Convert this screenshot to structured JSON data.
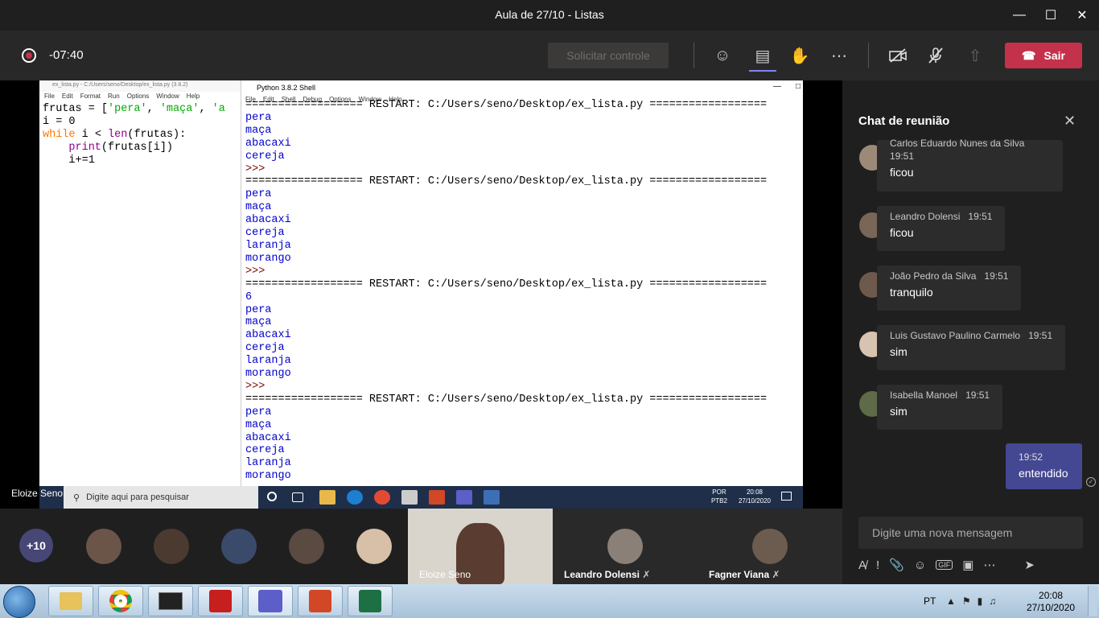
{
  "window": {
    "title": "Aula de 27/10 - Listas"
  },
  "toolbar": {
    "timer": "-07:40",
    "request_control": "Solicitar controle",
    "leave": "Sair"
  },
  "shared_screen": {
    "editor_title": "ex_lista.py - C:/Users/seno/Desktop/ex_lista.py (3.8.2)",
    "editor_menu": [
      "File",
      "Edit",
      "Format",
      "Run",
      "Options",
      "Window",
      "Help"
    ],
    "shell_title": "Python 3.8.2 Shell",
    "shell_menu": [
      "File",
      "Edit",
      "Shell",
      "Debug",
      "Options",
      "Window",
      "Help"
    ],
    "restart_line": "================== RESTART: C:/Users/seno/Desktop/ex_lista.py ==================",
    "prompt": ">>>",
    "run1": [
      "pera",
      "maça",
      "abacaxi",
      "cereja"
    ],
    "run2": [
      "pera",
      "maça",
      "abacaxi",
      "cereja",
      "laranja",
      "morango"
    ],
    "run3": [
      "6",
      "pera",
      "maça",
      "abacaxi",
      "cereja",
      "laranja",
      "morango"
    ],
    "run4": [
      "pera",
      "maça",
      "abacaxi",
      "cereja",
      "laranja",
      "morango"
    ],
    "search_placeholder": "Digite aqui para pesquisar",
    "tray_lang": "POR",
    "tray_kb": "PTB2",
    "tray_time": "20:08",
    "tray_date": "27/10/2020",
    "presenter": "Eloize Seno"
  },
  "chat": {
    "title": "Chat de reunião",
    "messages": [
      {
        "author": "Carlos Eduardo Nunes da Silva",
        "time": "19:51",
        "text": "ficou"
      },
      {
        "author": "Leandro Dolensi",
        "time": "19:51",
        "text": "ficou"
      },
      {
        "author": "João Pedro da Silva",
        "time": "19:51",
        "text": "tranquilo"
      },
      {
        "author": "Luis Gustavo Paulino Carmelo",
        "time": "19:51",
        "text": "sim"
      },
      {
        "author": "Isabella Manoel",
        "time": "19:51",
        "text": "sim"
      }
    ],
    "my_message": {
      "time": "19:52",
      "text": "entendido"
    },
    "compose_placeholder": "Digite uma nova mensagem"
  },
  "participants": {
    "more_count": "+10",
    "video_tile": "Eloize Seno",
    "tiles": [
      "Leandro Dolensi",
      "Fagner Viana"
    ]
  },
  "taskbar": {
    "lang": "PT",
    "time": "20:08",
    "date": "27/10/2020"
  },
  "colors": {
    "teams_accent": "#464775",
    "leave_red": "#c4314b",
    "my_bubble": "#444791"
  }
}
